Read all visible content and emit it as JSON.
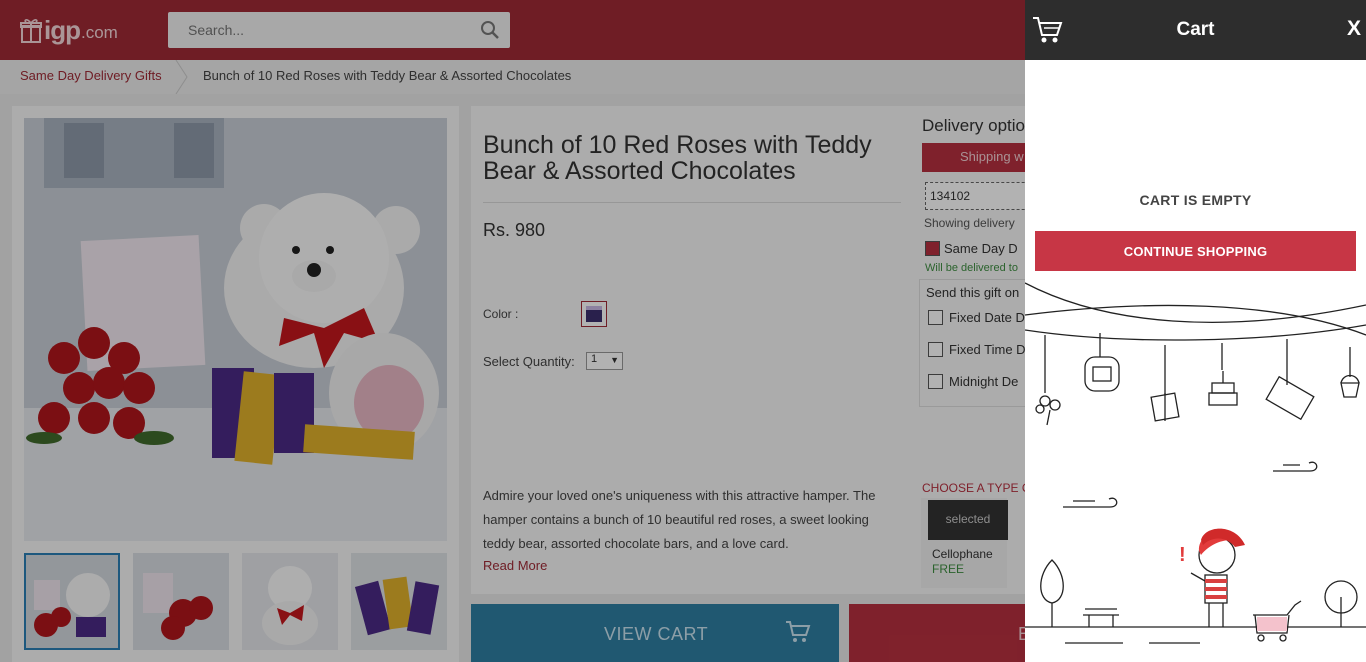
{
  "header": {
    "logo_word": "igp",
    "logo_domain": ".com",
    "search_placeholder": "Search..."
  },
  "breadcrumb": {
    "items": [
      "Same Day Delivery Gifts",
      "Bunch of 10 Red Roses with Teddy Bear & Assorted Chocolates"
    ]
  },
  "product": {
    "title": "Bunch of 10 Red Roses with Teddy Bear & Assorted Chocolates",
    "price": "Rs. 980",
    "color_label": "Color :",
    "quantity_label": "Select Quantity:",
    "quantity_value": "1",
    "description": "Admire your loved one's uniqueness with this attractive hamper. The hamper contains a bunch of 10 beautiful red roses, a sweet looking teddy bear, assorted chocolate bars, and a love card.",
    "read_more": "Read More"
  },
  "delivery": {
    "title": "Delivery optio",
    "shipping_button": "Shipping w",
    "pincode": "134102",
    "showing": "Showing delivery",
    "same_day": "Same Day D",
    "will_be": "Will be delivered to",
    "send_title": "Send this gift on",
    "options": [
      "Fixed Date D",
      "Fixed Time D",
      "Midnight De"
    ],
    "choose_type": "CHOOSE A TYPE O",
    "wrap": {
      "badge": "selected",
      "name": "Cellophane",
      "price": "FREE"
    }
  },
  "actions": {
    "view_cart": "VIEW CART",
    "buy_now": "B"
  },
  "cart": {
    "title": "Cart",
    "close": "X",
    "empty_text": "CART IS EMPTY",
    "continue_button": "CONTINUE SHOPPING"
  },
  "colors": {
    "brand": "#9f2a36",
    "accent": "#c73645",
    "view_cart": "#2f7fa3"
  }
}
